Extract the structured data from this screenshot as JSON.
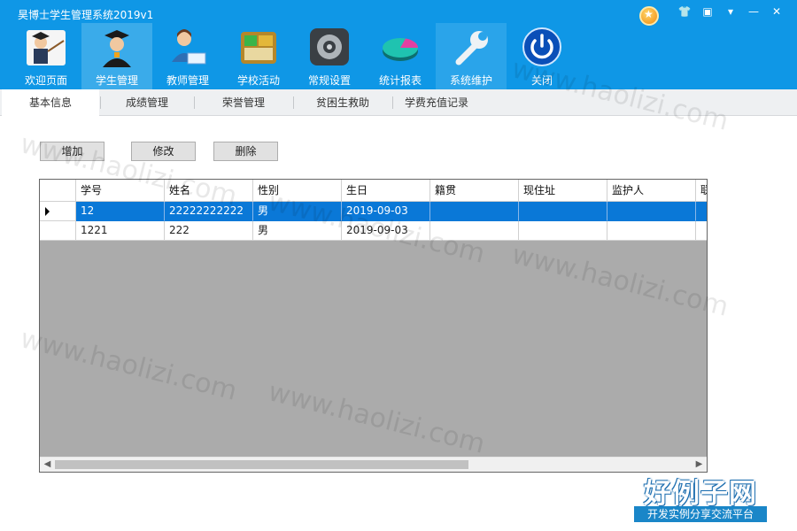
{
  "app": {
    "title": "昊博士学生管理系统2019v1"
  },
  "window_controls": [
    {
      "name": "medal-icon"
    },
    {
      "name": "skin-icon",
      "glyph": "👕"
    },
    {
      "name": "feedback-icon",
      "glyph": "▣"
    },
    {
      "name": "menu-icon",
      "glyph": "▾"
    },
    {
      "name": "minimize-icon",
      "glyph": "—"
    },
    {
      "name": "close-icon",
      "glyph": "✕"
    }
  ],
  "nav": {
    "items": [
      {
        "id": "welcome",
        "label": "欢迎页面",
        "icon": "teacher-pointer-icon"
      },
      {
        "id": "students",
        "label": "学生管理",
        "icon": "graduate-icon"
      },
      {
        "id": "teachers",
        "label": "教师管理",
        "icon": "teacher-icon"
      },
      {
        "id": "activities",
        "label": "学校活动",
        "icon": "activities-icon"
      },
      {
        "id": "settings",
        "label": "常规设置",
        "icon": "gear-icon"
      },
      {
        "id": "reports",
        "label": "统计报表",
        "icon": "pie-chart-icon"
      },
      {
        "id": "maintenance",
        "label": "系统维护",
        "icon": "wrench-icon"
      },
      {
        "id": "close",
        "label": "关闭",
        "icon": "power-icon"
      }
    ],
    "active": "students"
  },
  "tabs": [
    {
      "label": "基本信息",
      "active": true
    },
    {
      "label": "成绩管理"
    },
    {
      "label": "荣誉管理"
    },
    {
      "label": "贫困生救助"
    },
    {
      "label": "学费充值记录"
    }
  ],
  "toolbar": {
    "add_label": "增加",
    "edit_label": "修改",
    "delete_label": "删除"
  },
  "grid": {
    "columns": [
      "学号",
      "姓名",
      "性别",
      "生日",
      "籍贯",
      "现住址",
      "监护人",
      "联"
    ],
    "rows": [
      {
        "cells": [
          "12",
          "22222222222",
          "男",
          "2019-09-03",
          "",
          "",
          "",
          ""
        ],
        "selected": true
      },
      {
        "cells": [
          "1221",
          "222",
          "男",
          "2019-09-03",
          "",
          "",
          "",
          ""
        ],
        "selected": false
      }
    ]
  },
  "watermark": "www.haolizi.com",
  "brand": {
    "main": "好例子网",
    "sub": "开发实例分享交流平台"
  },
  "colors": {
    "ribbon": "#0f97e6",
    "selection": "#0a78d7",
    "grid_bg": "#ababab"
  }
}
